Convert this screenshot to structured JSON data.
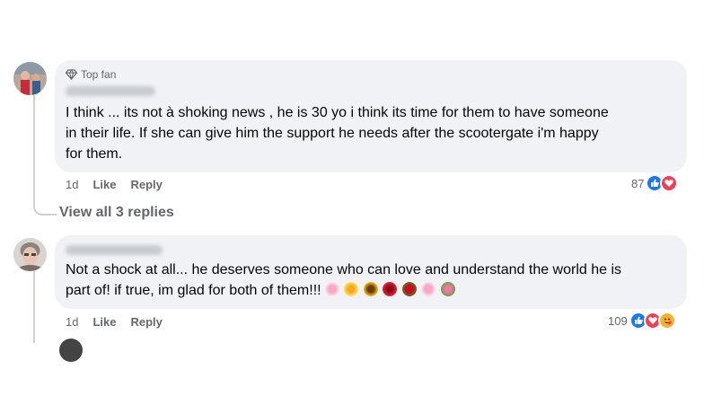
{
  "comments": [
    {
      "badge": "Top fan",
      "text_lines": [
        "I think ... its not à shoking news , he is 30 yo i think its time for them to have someone",
        "in their life. If she can give him the support he needs after the scootergate i'm happy",
        "for them."
      ],
      "time": "1d",
      "like_label": "Like",
      "reply_label": "Reply",
      "reaction_count": "87",
      "reactions": [
        "like-icon",
        "love-icon"
      ]
    },
    {
      "text_lines": [
        "Not a shock at all... he deserves someone who can love and understand the world he is",
        "part of! if true, im glad for both of them!!!"
      ],
      "emojis": [
        "cherry-blossom",
        "blossom",
        "sunflower",
        "hibiscus",
        "rose",
        "cherry-blossom",
        "bouquet"
      ],
      "time": "1d",
      "like_label": "Like",
      "reply_label": "Reply",
      "reaction_count": "109",
      "reactions": [
        "like-icon",
        "love-icon",
        "care-icon"
      ]
    }
  ],
  "view_replies_label": "View all 3 replies",
  "colors": {
    "bubble": "#f0f2f5",
    "like_blue": "#1877f2",
    "love_red": "#f33e58",
    "care_yellow": "#f7b125",
    "secondary_text": "#65676b"
  }
}
